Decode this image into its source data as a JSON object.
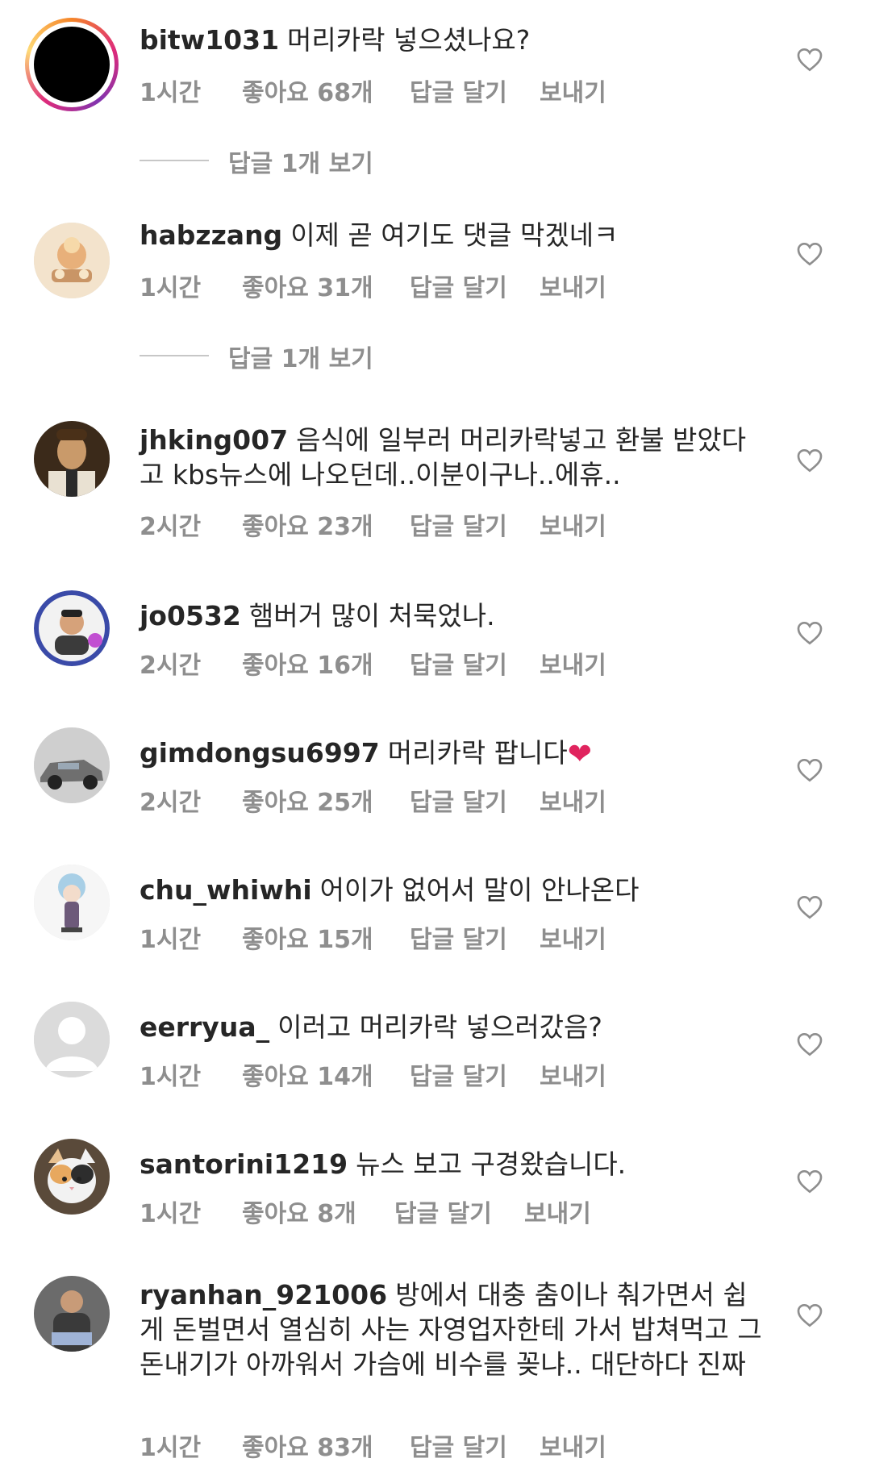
{
  "comments": [
    {
      "username": "bitw1031",
      "text": "머리카락 넣으셨나요?",
      "time": "1시간",
      "likes": "좋아요 68개",
      "reply": "답글 달기",
      "send": "보내기",
      "view_replies": "답글 1개 보기",
      "avatar": "story-ring-avatar"
    },
    {
      "username": "habzzang",
      "text": "이제 곧 여기도 댓글 막겠네ㅋ",
      "time": "1시간",
      "likes": "좋아요 31개",
      "reply": "답글 달기",
      "send": "보내기",
      "view_replies": "답글 1개 보기",
      "avatar": "illustration-avatar"
    },
    {
      "username": "jhking007",
      "text": "음식에 일부러 머리카락넣고 환불 받았다고 kbs뉴스에 나오던데..이분이구나..에휴..",
      "time": "2시간",
      "likes": "좋아요 23개",
      "reply": "답글 달기",
      "send": "보내기",
      "avatar": "photo-avatar"
    },
    {
      "username": "jo0532",
      "text": "햄버거 많이 처묵었나.",
      "time": "2시간",
      "likes": "좋아요 16개",
      "reply": "답글 달기",
      "send": "보내기",
      "avatar": "badge-photo-avatar"
    },
    {
      "username": "gimdongsu6997",
      "text": "머리카락 팝니다",
      "emoji": "❤",
      "time": "2시간",
      "likes": "좋아요 25개",
      "reply": "답글 달기",
      "send": "보내기",
      "avatar": "car-avatar"
    },
    {
      "username": "chu_whiwhi",
      "text": "어이가 없어서 말이 안나온다",
      "time": "1시간",
      "likes": "좋아요 15개",
      "reply": "답글 달기",
      "send": "보내기",
      "avatar": "anime-avatar"
    },
    {
      "username": "eerryua_",
      "text": "이러고 머리카락 넣으러갔음?",
      "time": "1시간",
      "likes": "좋아요 14개",
      "reply": "답글 달기",
      "send": "보내기",
      "avatar": "default-avatar"
    },
    {
      "username": "santorini1219",
      "text": "뉴스 보고 구경왔습니다.",
      "time": "1시간",
      "likes": "좋아요 8개",
      "reply": "답글 달기",
      "send": "보내기",
      "avatar": "cat-avatar"
    },
    {
      "username": "ryanhan_921006",
      "text": "방에서 대충 춤이나 춰가면서 쉽게 돈벌면서 열심히 사는 자영업자한테 가서 밥쳐먹고 그돈내기가 아까워서 가슴에 비수를 꽂냐.. 대단하다 진짜",
      "time": "1시간",
      "likes": "좋아요 83개",
      "reply": "답글 달기",
      "send": "보내기",
      "avatar": "person-avatar"
    }
  ],
  "icons": {
    "like": "heart-outline-icon"
  },
  "colors": {
    "text": "#262626",
    "meta": "#8e8e8e",
    "heart_emoji": "#e0245e"
  }
}
